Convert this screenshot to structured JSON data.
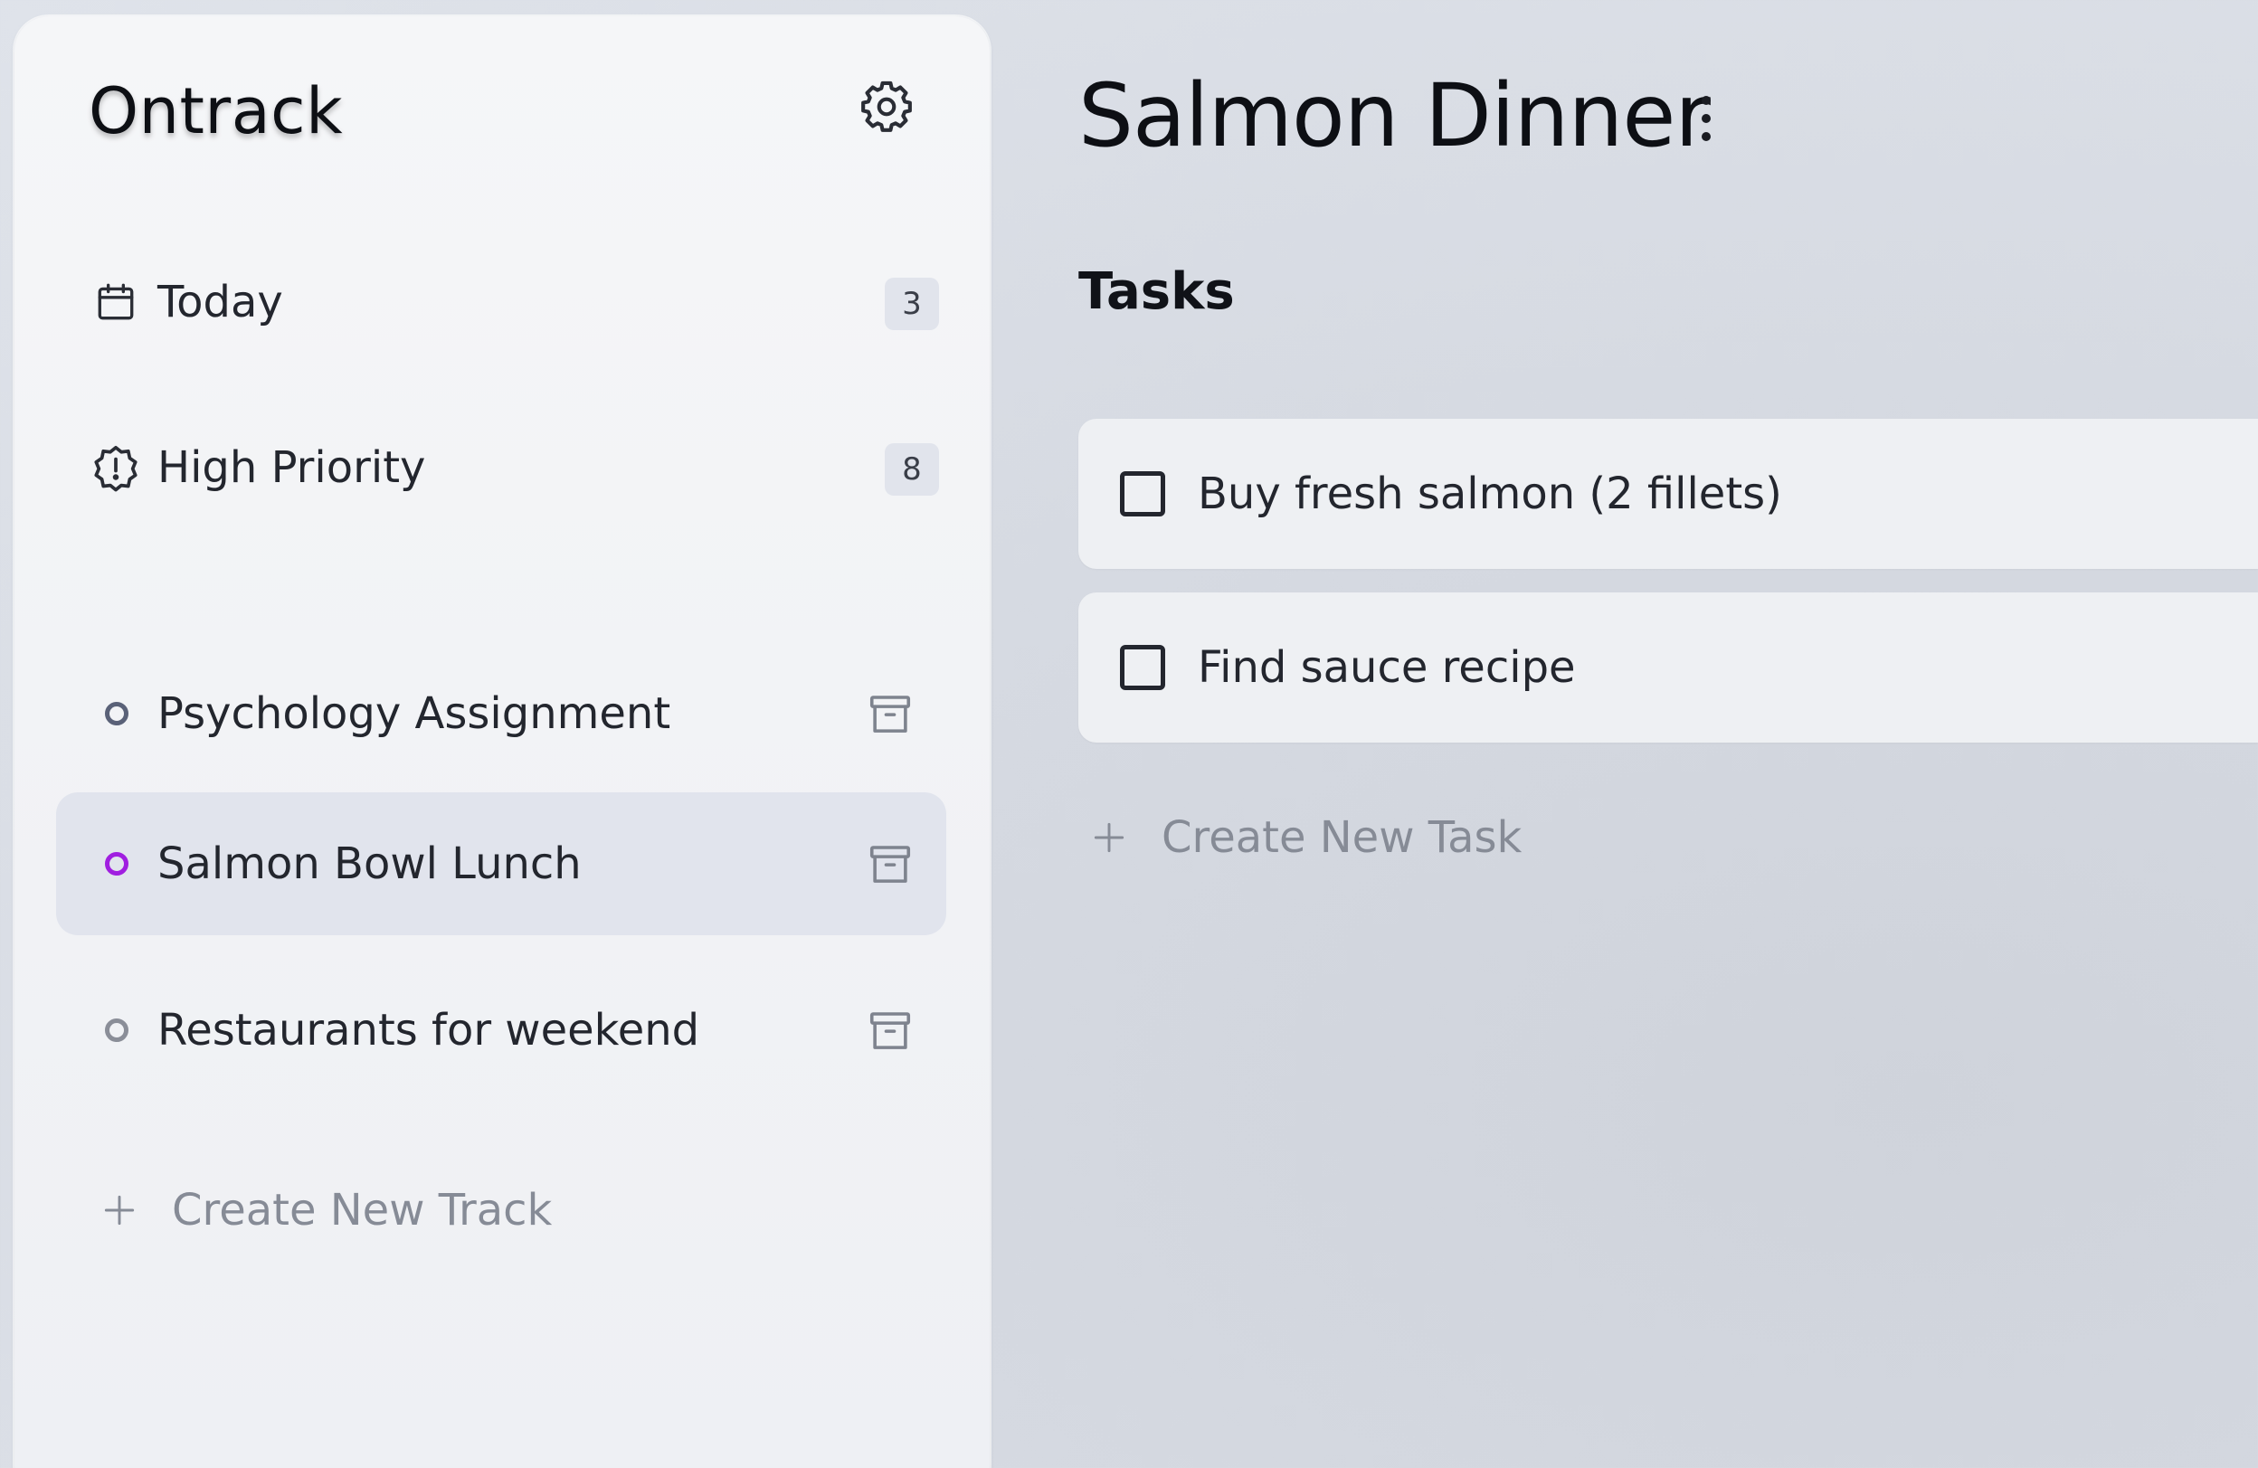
{
  "sidebar": {
    "app_title": "Ontrack",
    "settings_icon": "gear-icon",
    "nav": [
      {
        "label": "Today",
        "count": "3",
        "icon": "calendar-icon"
      },
      {
        "label": "High Priority",
        "count": "8",
        "icon": "alert-badge-icon"
      }
    ],
    "tracks": [
      {
        "label": "Psychology Assignment",
        "dot_color": "#5a6178",
        "active": false
      },
      {
        "label": "Salmon Bowl Lunch",
        "dot_color": "#a01ee0",
        "active": true
      },
      {
        "label": "Restaurants for weekend",
        "dot_color": "#8a8e98",
        "active": false
      }
    ],
    "create_track_label": "Create New Track"
  },
  "main": {
    "title": "Salmon Dinner",
    "more_icon": "more-vertical-icon",
    "section_title": "Tasks",
    "tasks": [
      {
        "label": "Buy fresh salmon (2 fillets)",
        "checked": false
      },
      {
        "label": "Find sauce recipe",
        "checked": false
      }
    ],
    "create_task_label": "Create New Task"
  },
  "colors": {
    "accent_purple": "#a01ee0",
    "active_track_bg": "#e1e4ed",
    "muted_text": "#868b96"
  }
}
